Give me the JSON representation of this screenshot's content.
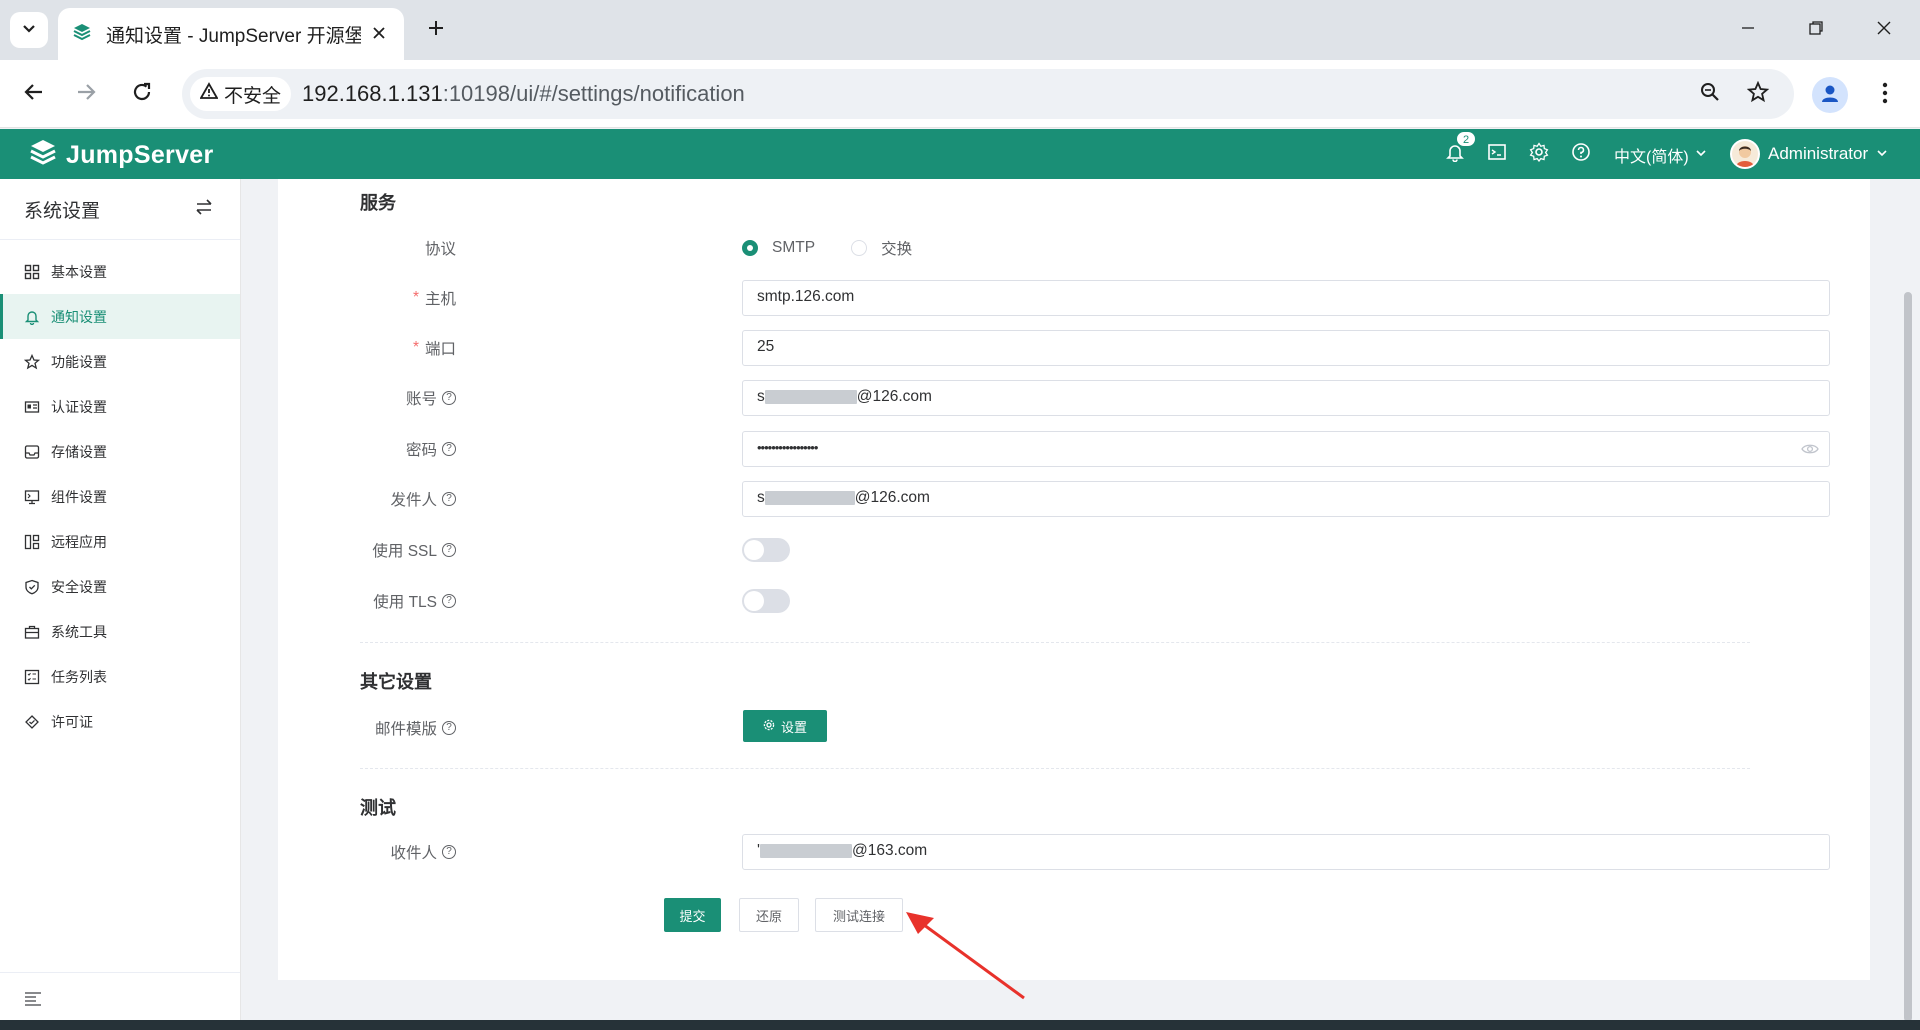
{
  "browser": {
    "tab_title": "通知设置 - JumpServer 开源堡",
    "security_label": "不安全",
    "url_host": "192.168.1.131",
    "url_rest": ":10198/ui/#/settings/notification"
  },
  "header": {
    "logo_text": "JumpServer",
    "notification_count": "2",
    "language": "中文(简体)",
    "user": "Administrator"
  },
  "sidebar": {
    "title": "系统设置",
    "items": [
      {
        "label": "基本设置",
        "icon": "grid-icon"
      },
      {
        "label": "通知设置",
        "icon": "bell-icon"
      },
      {
        "label": "功能设置",
        "icon": "star-box-icon"
      },
      {
        "label": "认证设置",
        "icon": "id-card-icon"
      },
      {
        "label": "存储设置",
        "icon": "inbox-icon"
      },
      {
        "label": "组件设置",
        "icon": "monitor-icon"
      },
      {
        "label": "远程应用",
        "icon": "apps-icon"
      },
      {
        "label": "安全设置",
        "icon": "shield-icon"
      },
      {
        "label": "系统工具",
        "icon": "toolbox-icon"
      },
      {
        "label": "任务列表",
        "icon": "checklist-icon"
      },
      {
        "label": "许可证",
        "icon": "license-icon"
      }
    ],
    "active_index": 1
  },
  "form": {
    "service_title": "服务",
    "protocol_label": "协议",
    "protocol_options": [
      "SMTP",
      "交换"
    ],
    "protocol_selected": "SMTP",
    "host_label": "主机",
    "host_value": "smtp.126.com",
    "port_label": "端口",
    "port_value": "25",
    "account_label": "账号",
    "account_value_prefix": "s",
    "account_value_suffix": "@126.com",
    "password_label": "密码",
    "password_value": "•••••••••••••••••",
    "sender_label": "发件人",
    "sender_value_prefix": "s",
    "sender_value_suffix": "@126.com",
    "ssl_label": "使用 SSL",
    "ssl_enabled": false,
    "tls_label": "使用 TLS",
    "tls_enabled": false,
    "other_title": "其它设置",
    "template_label": "邮件模版",
    "template_button": "设置",
    "test_title": "测试",
    "recipient_label": "收件人",
    "recipient_value_prefix": "'",
    "recipient_value_suffix": "@163.com",
    "submit_button": "提交",
    "reset_button": "还原",
    "test_button": "测试连接"
  },
  "colors": {
    "brand": "#1a8f76",
    "annotation_arrow": "#e8322b"
  }
}
